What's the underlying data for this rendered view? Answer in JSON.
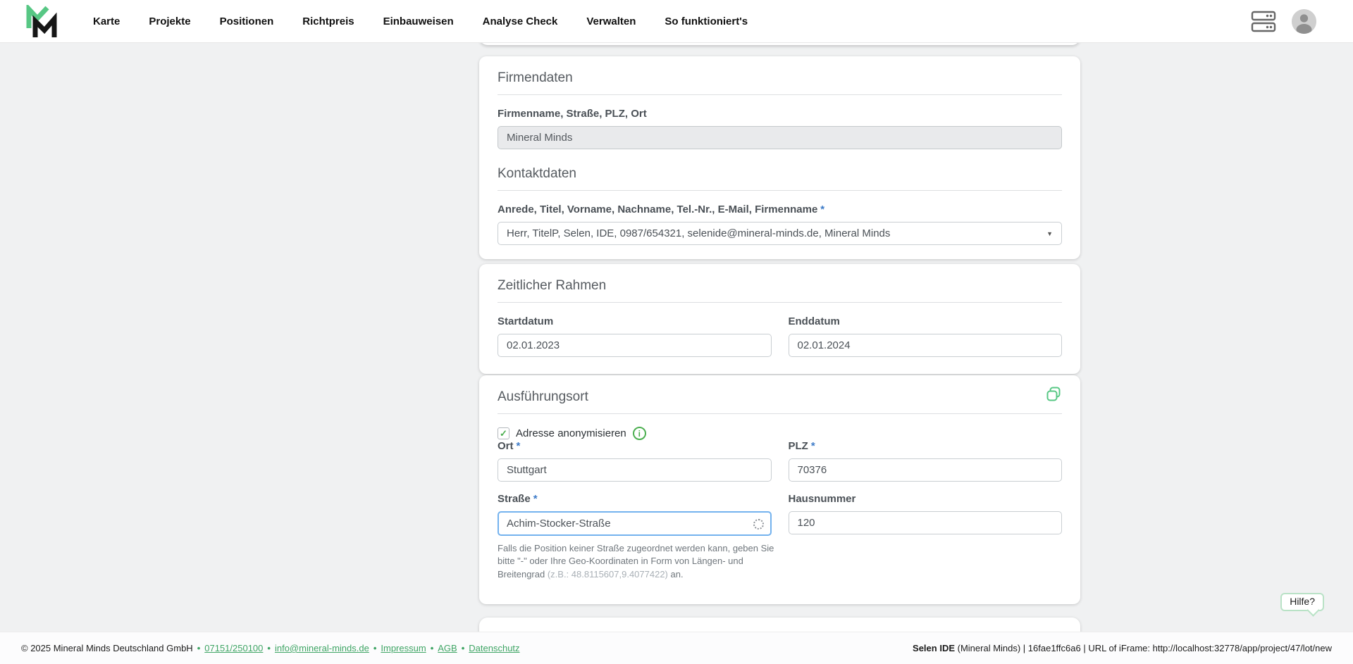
{
  "icons": {
    "caret_down": "▼",
    "check": "✓",
    "info_i": "i"
  },
  "nav": {
    "items": [
      "Karte",
      "Projekte",
      "Positionen",
      "Richtpreis",
      "Einbauweisen",
      "Analyse Check",
      "Verwalten",
      "So funktioniert's"
    ]
  },
  "cards": {
    "firmendaten": {
      "title": "Firmendaten",
      "company_label": "Firmenname, Straße, PLZ, Ort",
      "company_value": "Mineral Minds",
      "kontakt_title": "Kontaktdaten",
      "kontakt_label": "Anrede, Titel, Vorname, Nachname, Tel.-Nr., E-Mail, Firmenname",
      "required": "*",
      "kontakt_value": "Herr, TitelP, Selen, IDE, 0987/654321, selenide@mineral-minds.de, Mineral Minds"
    },
    "zeit": {
      "title": "Zeitlicher Rahmen",
      "start_label": "Startdatum",
      "start_value": "02.01.2023",
      "end_label": "Enddatum",
      "end_value": "02.01.2024"
    },
    "ort": {
      "title": "Ausführungsort",
      "anonymize_label": "Adresse anonymisieren",
      "ort_label": "Ort",
      "ort_value": "Stuttgart",
      "plz_label": "PLZ",
      "plz_value": "70376",
      "strasse_label": "Straße",
      "strasse_value": "Achim-Stocker-Straße",
      "hausnummer_label": "Hausnummer",
      "hausnummer_value": "120",
      "required": "*",
      "help_part1": "Falls die Position keiner Straße zugeordnet werden kann, geben Sie bitte \"-\" oder Ihre Geo-Koordinaten in Form von Längen- und Breitengrad ",
      "help_muted": "(z.B.: 48.8115607,9.4077422)",
      "help_part2": " an."
    }
  },
  "help_button_label": "Hilfe?",
  "footer": {
    "copyright": "© 2025 Mineral Minds Deutschland GmbH",
    "separator": "•",
    "links": [
      "07151/250100",
      "info@mineral-minds.de",
      "Impressum",
      "AGB",
      "Datenschutz"
    ],
    "right_app": "Selen IDE",
    "right_info": "(Mineral Minds) | 16fae1ffc6a6 | URL of iFrame: http://localhost:32778/app/project/47/lot/new"
  },
  "colors": {
    "brand_green": "#57c784",
    "accent_green": "#4caf50",
    "link_green": "#3fa565",
    "asterisk_blue": "#3d7bc8",
    "focus_blue": "#74b2ee"
  }
}
